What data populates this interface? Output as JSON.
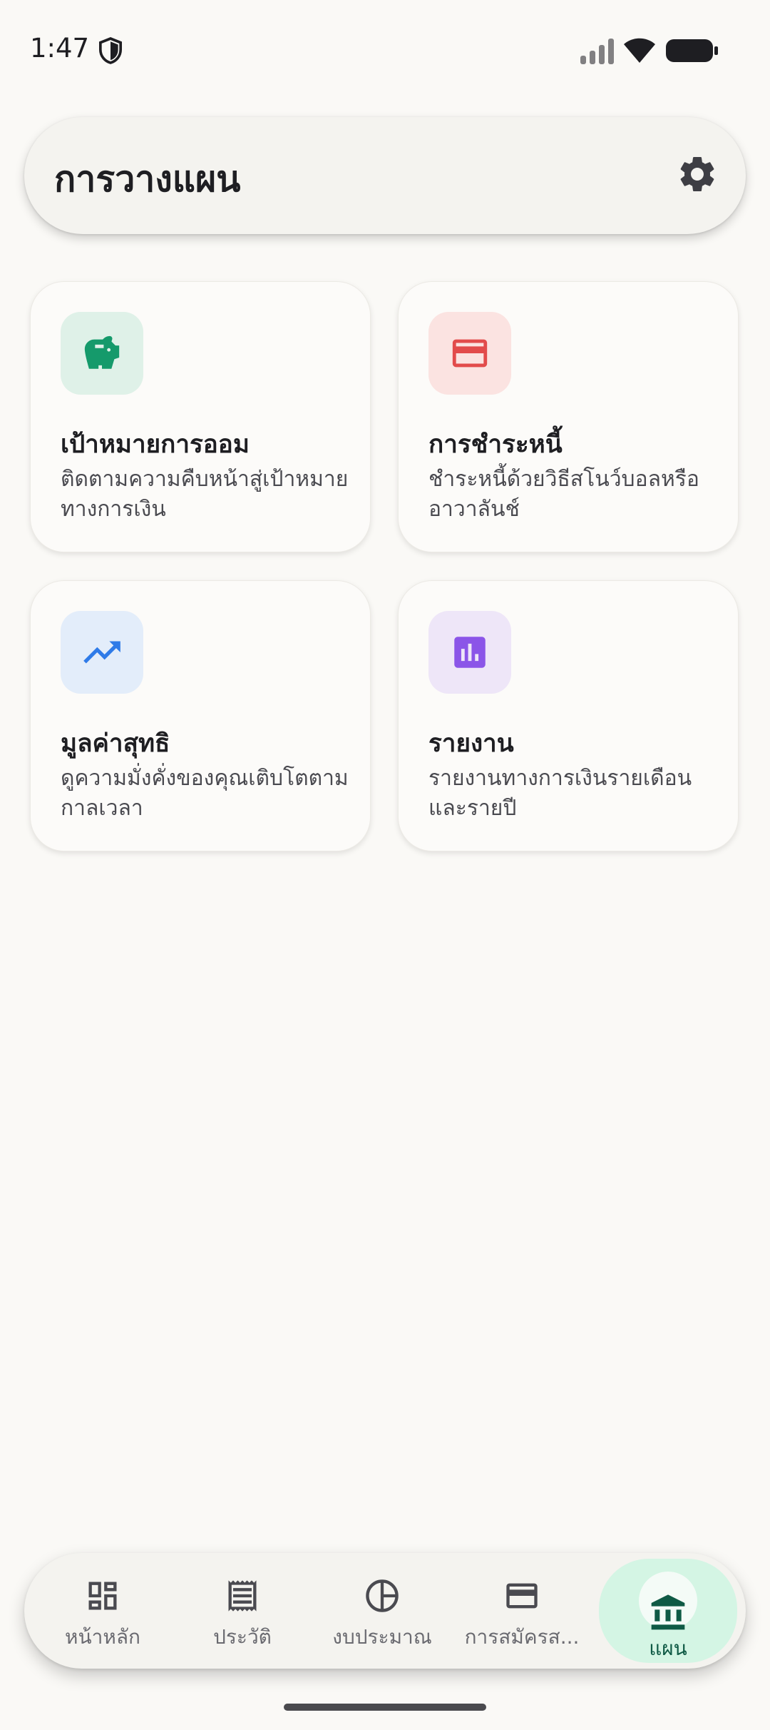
{
  "status_bar": {
    "time": "1:47"
  },
  "header": {
    "title": "การวางแผน"
  },
  "cards": [
    {
      "title": "เป้าหมายการออม",
      "description": "ติดตามความคืบหน้าสู่เป้าหมายทางการเงิน",
      "icon": "piggy-bank-icon",
      "icon_color": "#159A6B",
      "icon_bg": "#DFF1E8"
    },
    {
      "title": "การชำระหนี้",
      "description": "ชำระหนี้ด้วยวิธีสโนว์บอลหรืออาวาลันช์",
      "icon": "credit-card-icon",
      "icon_color": "#E24B4B",
      "icon_bg": "#FBE3E1"
    },
    {
      "title": "มูลค่าสุทธิ",
      "description": "ดูความมั่งคั่งของคุณเติบโตตามกาลเวลา",
      "icon": "trending-up-icon",
      "icon_color": "#2F7BE8",
      "icon_bg": "#E3EDFA"
    },
    {
      "title": "รายงาน",
      "description": "รายงานทางการเงินรายเดือนและรายปี",
      "icon": "bar-chart-icon",
      "icon_color": "#8B55E8",
      "icon_bg": "#EEE6F8"
    }
  ],
  "bottom_nav": {
    "items": [
      {
        "label": "หน้าหลัก",
        "icon": "dashboard-icon"
      },
      {
        "label": "ประวัติ",
        "icon": "receipt-icon"
      },
      {
        "label": "งบประมาณ",
        "icon": "pie-chart-icon"
      },
      {
        "label": "การสมัครส...",
        "icon": "credit-card-icon"
      },
      {
        "label": "แผน",
        "icon": "bank-icon",
        "active": true
      }
    ]
  }
}
